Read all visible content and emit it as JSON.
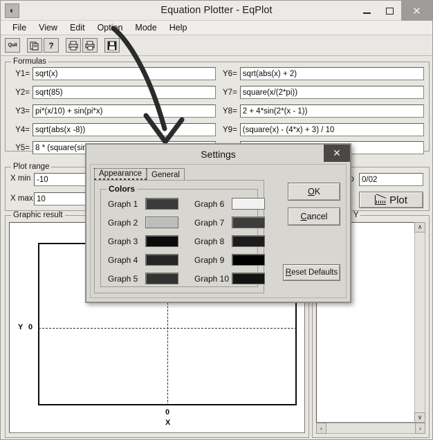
{
  "window": {
    "title": "Equation Plotter - EqPlot",
    "icon": "app-icon",
    "minimize": "minimize-icon",
    "maximize": "maximize-icon",
    "close": "close-icon"
  },
  "menubar": {
    "items": [
      "File",
      "View",
      "Edit",
      "Option",
      "Mode",
      "Help"
    ]
  },
  "toolbar": {
    "buttons": [
      {
        "name": "quit-button",
        "label": "Quit",
        "icon": "quit-icon"
      },
      {
        "name": "copy-button",
        "label": "",
        "icon": "copy-icon"
      },
      {
        "name": "help-button",
        "label": "?",
        "icon": "question-icon"
      },
      {
        "name": "print-preview-button",
        "label": "",
        "icon": "print-preview-icon"
      },
      {
        "name": "print-button",
        "label": "",
        "icon": "printer-icon"
      },
      {
        "name": "save-button",
        "label": "",
        "icon": "floppy-disk-icon"
      }
    ]
  },
  "formulas": {
    "legend": "Formulas",
    "left": [
      {
        "label": "Y1=",
        "value": "sqrt(x)"
      },
      {
        "label": "Y2=",
        "value": "sqrt(85)"
      },
      {
        "label": "Y3=",
        "value": "pi*(x/10) + sin(pi*x)"
      },
      {
        "label": "Y4=",
        "value": "sqrt(abs(x -8))"
      },
      {
        "label": "Y5=",
        "value": "8 * (square(sin("
      }
    ],
    "right": [
      {
        "label": "Y6=",
        "value": "sqrt(abs(x) + 2)"
      },
      {
        "label": "Y7=",
        "value": "square(x/(2*pi))"
      },
      {
        "label": "Y8=",
        "value": "2 + 4*sin(2*(x - 1))"
      },
      {
        "label": "Y9=",
        "value": "(square(x) - (4*x) + 3) / 10"
      }
    ]
  },
  "plot_range": {
    "legend": "Plot range",
    "x_min_label": "X min",
    "x_min_value": "-10",
    "x_max_label": "X max",
    "x_max_value": "10",
    "step_label": "ep",
    "step_value": "0/02",
    "plot_button": "Plot"
  },
  "graphic_result": {
    "legend": "Graphic result",
    "y_axis_label": "Y",
    "y_tick": "0",
    "x_axis_label": "X",
    "x_tick": "0"
  },
  "x_versus_y": {
    "legend": "X versus Y",
    "scroll_up": "∧",
    "scroll_down": "∨",
    "scroll_left": "‹",
    "scroll_right": "›"
  },
  "settings_dialog": {
    "title": "Settings",
    "close": "close-icon",
    "tabs": [
      {
        "label": "Appearance",
        "active": true
      },
      {
        "label": "General",
        "active": false
      }
    ],
    "colors_legend": "Colors",
    "graphs": [
      {
        "label": "Graph 1",
        "color": "#3b3b3b"
      },
      {
        "label": "Graph 2",
        "color": "#bdbdbd"
      },
      {
        "label": "Graph 3",
        "color": "#0c0c0c"
      },
      {
        "label": "Graph 4",
        "color": "#262626"
      },
      {
        "label": "Graph 5",
        "color": "#333333"
      },
      {
        "label": "Graph 6",
        "color": "#f2f2f2"
      },
      {
        "label": "Graph 7",
        "color": "#3d3d3d"
      },
      {
        "label": "Graph 8",
        "color": "#1c1c1c"
      },
      {
        "label": "Graph 9",
        "color": "#000000"
      },
      {
        "label": "Graph 10",
        "color": "#131313"
      }
    ],
    "buttons": {
      "ok": "OK",
      "cancel": "Cancel",
      "reset_defaults": "Reset Defaults"
    }
  }
}
